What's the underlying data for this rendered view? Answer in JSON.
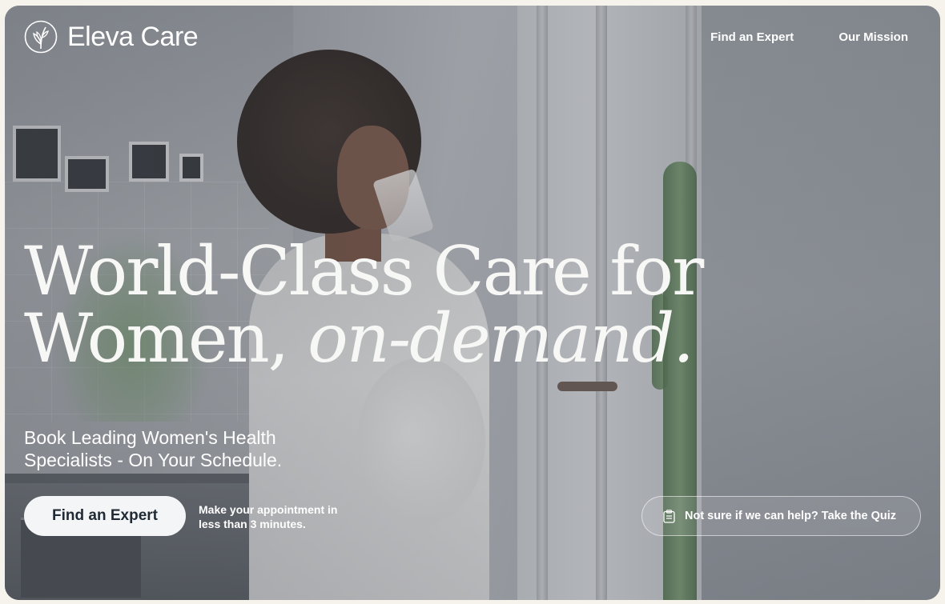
{
  "brand": {
    "name": "Eleva Care",
    "logo_icon": "olive-branch-icon"
  },
  "nav": {
    "items": [
      {
        "label": "Find an Expert"
      },
      {
        "label": "Our Mission"
      }
    ]
  },
  "hero": {
    "headline_line1": "World-Class Care for",
    "headline_line2_plain": "Women, ",
    "headline_line2_italic": "on-demand.",
    "subheadline": "Book Leading Women's Health Specialists - On Your Schedule.",
    "primary_cta": "Find an Expert",
    "cta_note": "Make your appointment in less than 3 minutes.",
    "quiz_cta": "Not sure if we can help? Take the Quiz",
    "quiz_icon": "clipboard-icon"
  },
  "colors": {
    "page_background": "#f6f2ec",
    "text_light": "#ffffff",
    "button_background": "#f4f5f6",
    "button_text": "#1f2a34"
  }
}
